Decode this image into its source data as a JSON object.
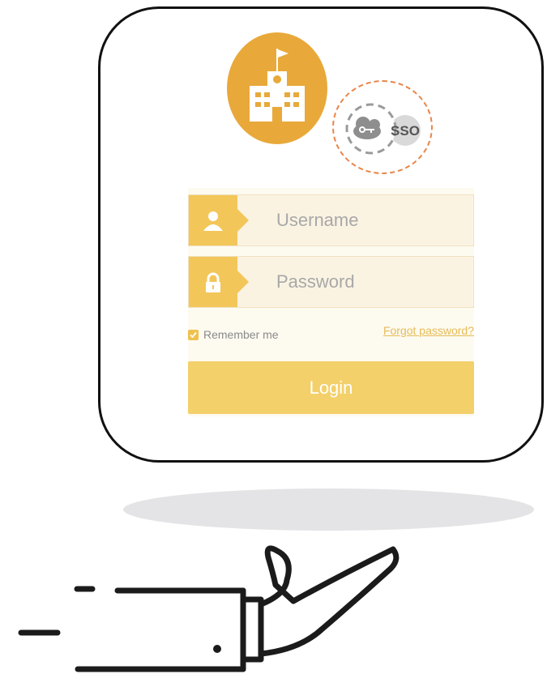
{
  "login_form": {
    "username_placeholder": "Username",
    "password_placeholder": "Password",
    "remember_label": "Remember me",
    "remember_checked": true,
    "forgot_label": "Forgot password?",
    "login_label": "Login"
  },
  "sso_badge": {
    "label": "SSO"
  },
  "icons": {
    "logo": "school-building-icon",
    "sso": "cloud-key-icon",
    "username": "user-icon",
    "password": "lock-icon",
    "hand": "hand-presenting-icon"
  },
  "colors": {
    "logo_orange": "#e8a93a",
    "field_accent": "#f3c65a",
    "login_button": "#f3d06a",
    "sso_ring": "#e8864a",
    "link": "#e6bc55"
  }
}
